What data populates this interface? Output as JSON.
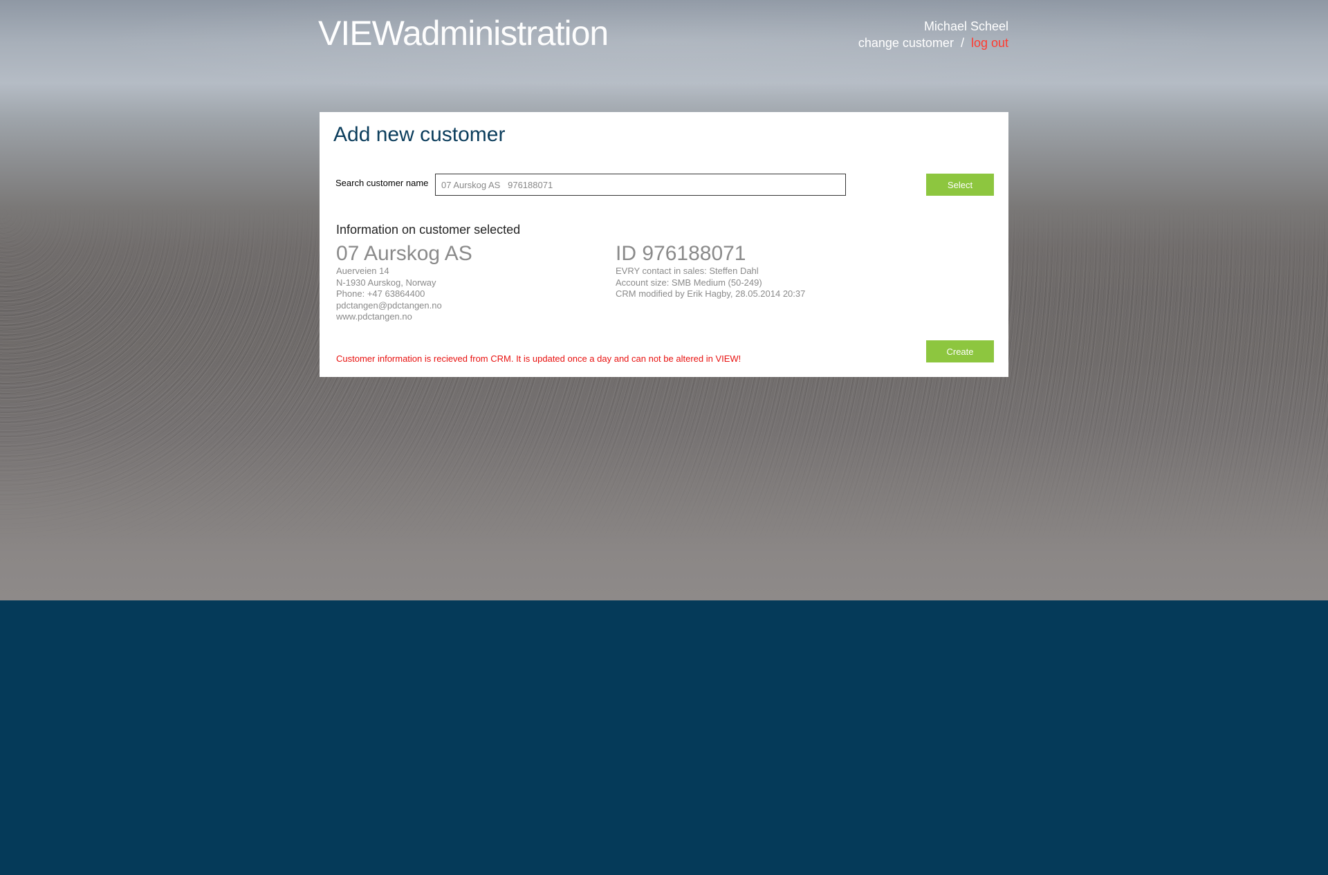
{
  "header": {
    "logo_strong": "VIEW",
    "logo_light": "administration",
    "user_name": "Michael Scheel",
    "change_customer": "change customer",
    "separator": "/",
    "logout": "log out"
  },
  "card": {
    "title": "Add new customer",
    "search": {
      "label": "Search customer name",
      "value": "07 Aurskog AS   976188071"
    },
    "select_button": "Select",
    "info_heading": "Information on customer selected",
    "customer": {
      "name": "07 Aurskog AS",
      "address": "Auerveien 14",
      "postal": "N-1930 Aurskog, Norway",
      "phone": "Phone: +47 63864400",
      "email": "pdctangen@pdctangen.no",
      "web": "www.pdctangen.no"
    },
    "details": {
      "id": "ID 976188071",
      "sales_contact": "EVRY contact in sales: Steffen Dahl",
      "account_size": "Account size: SMB Medium (50-249)",
      "crm_modified": "CRM modified by Erik Hagby, 28.05.2014 20:37"
    },
    "notice": "Customer information is recieved from CRM. It is updated once a day and can not be altered in VIEW!",
    "create_button": "Create"
  },
  "colors": {
    "accent_green": "#8dc63f",
    "title_blue": "#0b3d5c",
    "footer_navy": "#053a59",
    "warning_red": "#e8110f",
    "logout_red": "#ff3b30"
  }
}
